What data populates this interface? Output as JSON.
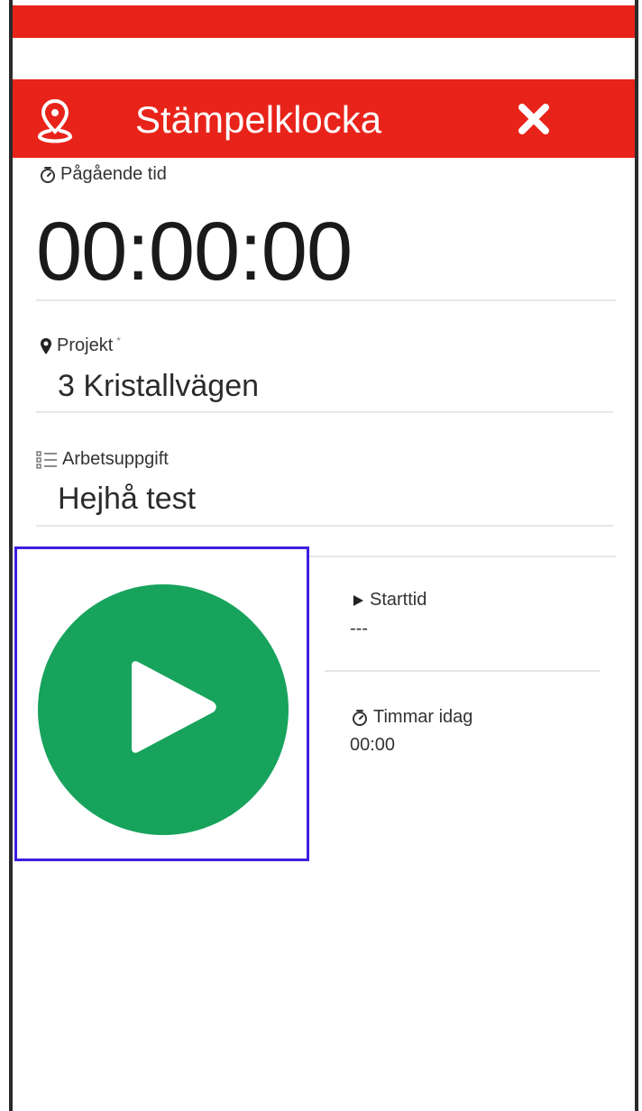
{
  "header": {
    "title": "Stämpelklocka",
    "color": "#e8231a"
  },
  "timer": {
    "label": "Pågående tid",
    "value": "00:00:00"
  },
  "project": {
    "label": "Projekt",
    "required_mark": "*",
    "value": "3 Kristallvägen"
  },
  "task": {
    "label": "Arbetsuppgift",
    "value": "Hejhå test"
  },
  "start": {
    "label": "Starttid",
    "value": "---"
  },
  "hours_today": {
    "label": "Timmar idag",
    "value": "00:00"
  },
  "play_button": {
    "color": "#17a35c",
    "highlight_color": "#3a1fe0"
  },
  "icons": [
    "location-pin-icon",
    "close-icon",
    "stopwatch-icon",
    "map-marker-icon",
    "task-list-icon",
    "play-icon",
    "play-triangle-icon"
  ]
}
